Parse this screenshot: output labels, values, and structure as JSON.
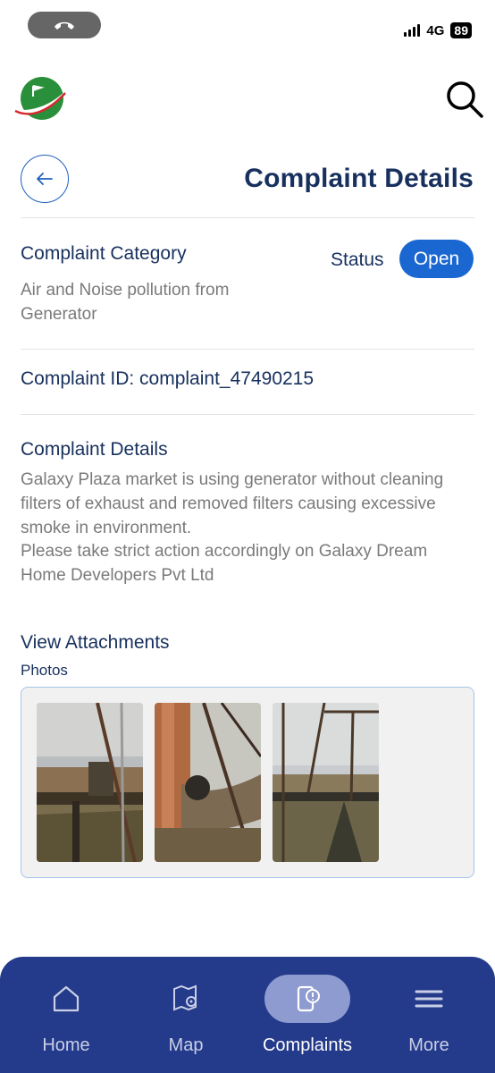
{
  "status_bar": {
    "network": "4G",
    "battery": "89"
  },
  "header": {
    "title": "Complaint Details"
  },
  "category": {
    "label": "Complaint Category",
    "value": "Air and Noise pollution from Generator",
    "status_label": "Status",
    "status_value": "Open"
  },
  "complaint_id": {
    "text": "Complaint ID: complaint_47490215"
  },
  "details": {
    "label": "Complaint Details",
    "line1": "Galaxy Plaza market is using generator without cleaning filters of exhaust and removed filters causing excessive smoke in environment.",
    "line2": "Please take strict action accordingly on Galaxy Dream Home Developers Pvt Ltd"
  },
  "attachments": {
    "label": "View Attachments",
    "photos_label": "Photos"
  },
  "nav": {
    "items": [
      {
        "label": "Home",
        "icon": "home-icon"
      },
      {
        "label": "Map",
        "icon": "map-icon"
      },
      {
        "label": "Complaints",
        "icon": "complaints-icon"
      },
      {
        "label": "More",
        "icon": "menu-icon"
      }
    ],
    "active": "Complaints"
  },
  "colors": {
    "primary": "#17305e",
    "accent": "#1a67d2",
    "nav_bg": "#243a8a",
    "muted_text": "#7a7a7a"
  }
}
